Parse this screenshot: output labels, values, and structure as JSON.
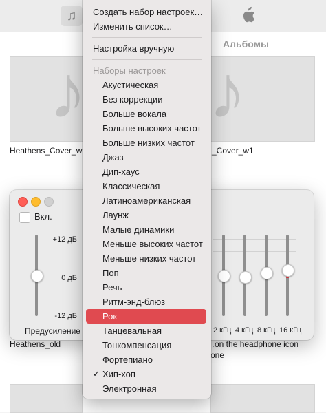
{
  "background": {
    "subnav_albums": "Альбомы",
    "albums": [
      {
        "title": "Heathens_Cover_w"
      },
      {
        "title": "_Cover_w1"
      },
      {
        "title": "Heathens_old"
      },
      {
        "title": "…on the headphone icon"
      },
      {
        "title": "one"
      }
    ]
  },
  "equalizer": {
    "enabled_label": "Вкл.",
    "enabled": false,
    "db_top": "+12 дБ",
    "db_mid": "0 дБ",
    "db_bottom": "-12 дБ",
    "preamp_label": "Предусиление",
    "preamp_level_db": 0,
    "bands": [
      {
        "label": "2 кГц",
        "level_db": 0
      },
      {
        "label": "4 кГц",
        "level_db": -0.5
      },
      {
        "label": "8 кГц",
        "level_db": 1
      },
      {
        "label": "16 кГц",
        "level_db": 2
      }
    ]
  },
  "menu": {
    "top_items": [
      "Создать набор настроек…",
      "Изменить список…"
    ],
    "manual_item": "Настройка вручную",
    "presets_header": "Наборы настроек",
    "presets": [
      "Акустическая",
      "Без коррекции",
      "Больше вокала",
      "Больше высоких частот",
      "Больше низких частот",
      "Джаз",
      "Дип-хаус",
      "Классическая",
      "Латиноамериканская",
      "Лаунж",
      "Малые динамики",
      "Меньше высоких частот",
      "Меньше низких частот",
      "Поп",
      "Речь",
      "Ритм-энд-блюз",
      "Рок",
      "Танцевальная",
      "Тонкомпенсация",
      "Фортепиано",
      "Хип-хоп",
      "Электронная"
    ],
    "highlighted": "Рок",
    "checked": "Хип-хоп",
    "check_glyph": "✓"
  },
  "colors": {
    "highlight": "#e04a50",
    "slider_fill": "#e2363d",
    "close": "#ff5f57",
    "minimize": "#febc2e"
  },
  "icons": [
    "music-note-icon",
    "apple-logo-icon",
    "checkmark-icon"
  ]
}
